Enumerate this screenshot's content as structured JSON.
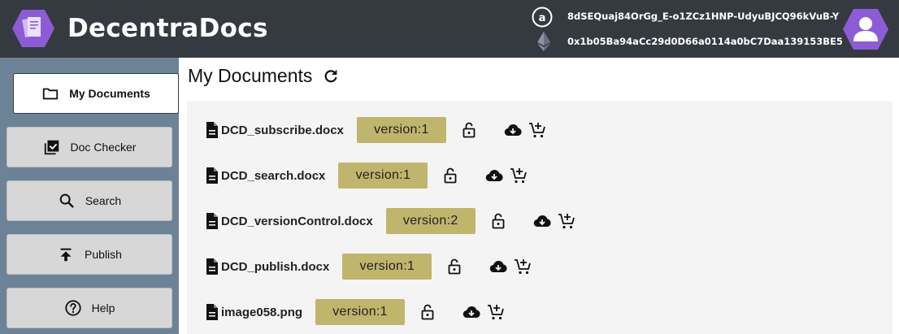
{
  "header": {
    "title": "DecentraDocs",
    "arweave_address": "8dSEQuaj84OrGg_E-o1ZCz1HNP-UdyuBJCQ96kVuB-Y",
    "eth_address": "0x1b05Ba94aCc29d0D66a0114a0bC7Daa139153BE5"
  },
  "sidebar": {
    "items": [
      {
        "label": "My Documents",
        "icon": "folder-icon"
      },
      {
        "label": "Doc Checker",
        "icon": "library-check-icon"
      },
      {
        "label": "Search",
        "icon": "search-icon"
      },
      {
        "label": "Publish",
        "icon": "publish-icon"
      },
      {
        "label": "Help",
        "icon": "help-icon"
      }
    ]
  },
  "main": {
    "title": "My Documents",
    "documents": [
      {
        "name": "DCD_subscribe.docx",
        "version": "version:1"
      },
      {
        "name": "DCD_search.docx",
        "version": "version:1"
      },
      {
        "name": "DCD_versionControl.docx",
        "version": "version:2"
      },
      {
        "name": "DCD_publish.docx",
        "version": "version:1"
      },
      {
        "name": "image058.png",
        "version": "version:1"
      }
    ]
  },
  "colors": {
    "header_bg": "#343a40",
    "sidebar_bg": "#6c8397",
    "version_badge": "#bfb56c",
    "logo_purple": "#8e5bd6"
  }
}
